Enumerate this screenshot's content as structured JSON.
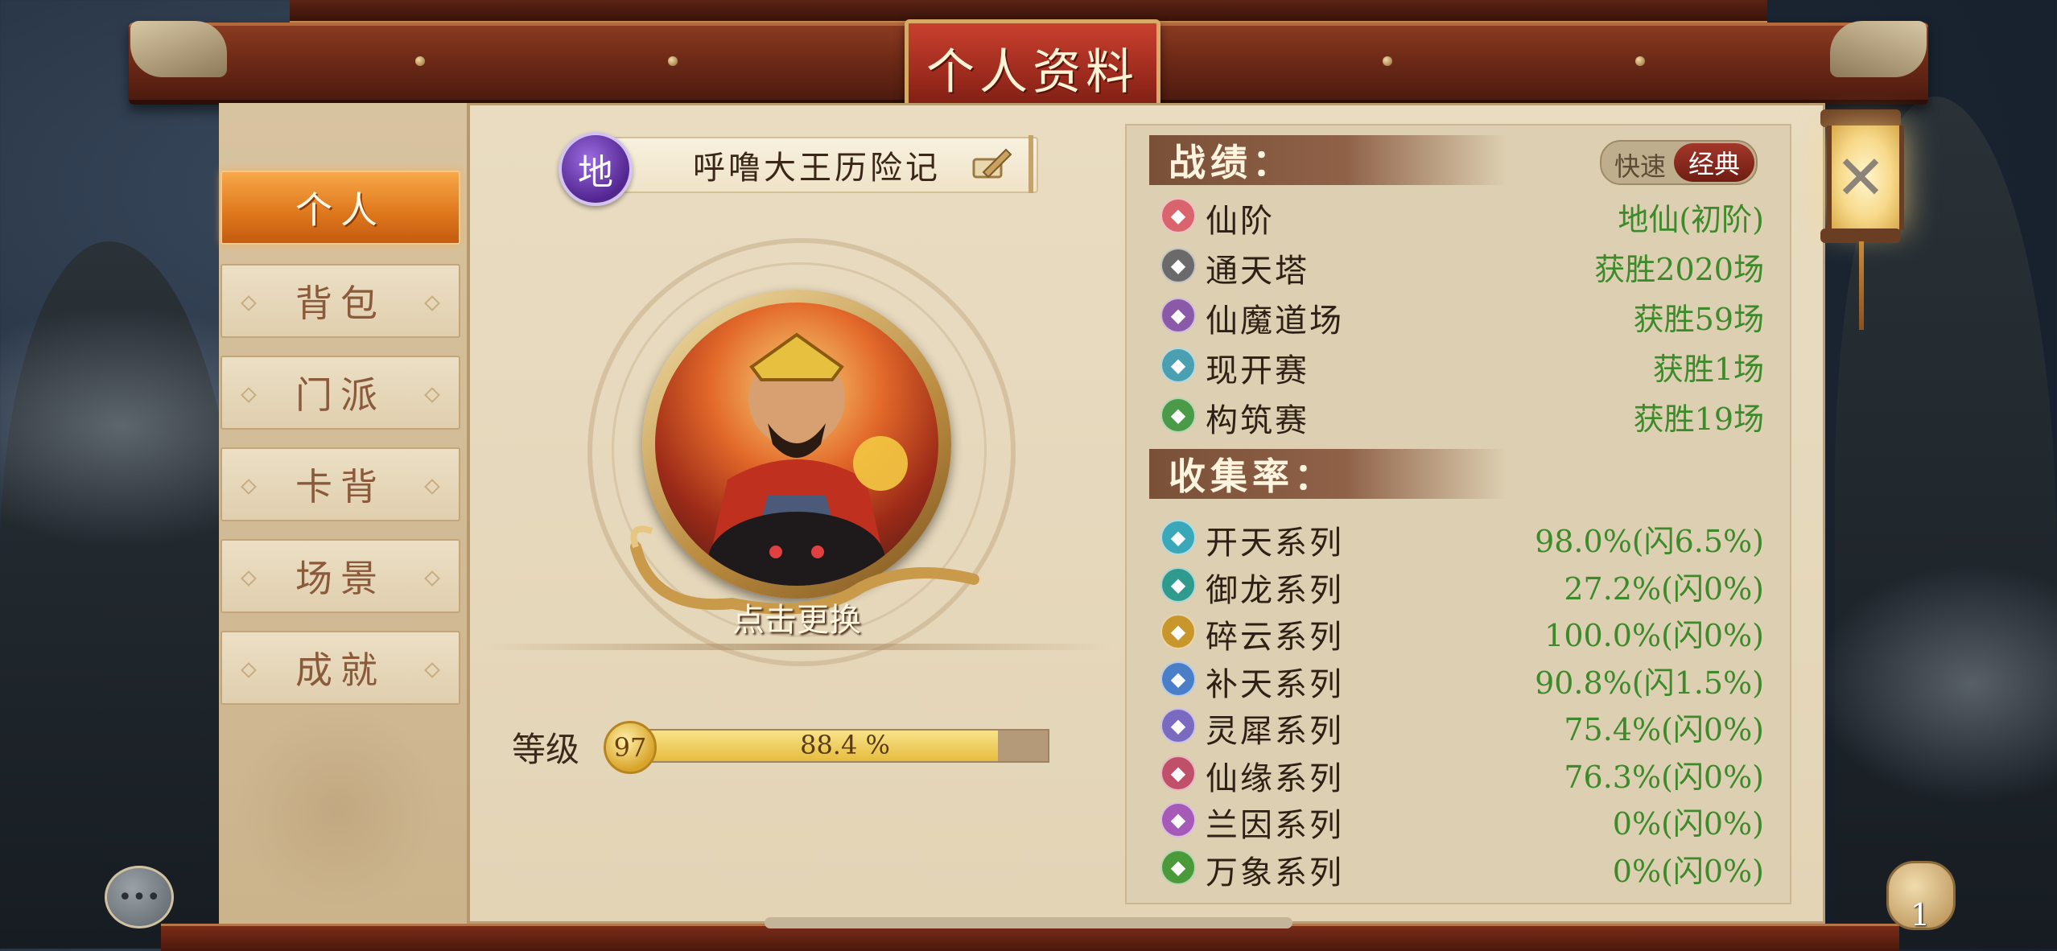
{
  "header": {
    "title": "个人资料"
  },
  "sidebar": {
    "items": [
      {
        "label": "个人",
        "active": true
      },
      {
        "label": "背包",
        "active": false
      },
      {
        "label": "门派",
        "active": false
      },
      {
        "label": "卡背",
        "active": false
      },
      {
        "label": "场景",
        "active": false
      },
      {
        "label": "成就",
        "active": false
      }
    ]
  },
  "profile": {
    "rank_badge": "地",
    "name": "呼噜大王历险记",
    "change_avatar_label": "点击更换",
    "level_label": "等级",
    "level": "97",
    "level_progress_text": "88.4 %",
    "level_progress": 0.884
  },
  "record": {
    "title": "战绩：",
    "mode_toggle": {
      "options": [
        "快速",
        "经典"
      ],
      "selected": "经典"
    },
    "rows": [
      {
        "icon": "star-icon",
        "icon_color": "#d9646e",
        "label": "仙阶",
        "value": "地仙(初阶)"
      },
      {
        "icon": "tower-icon",
        "icon_color": "#6a6a6a",
        "label": "通天塔",
        "value": "获胜2020场"
      },
      {
        "icon": "crane-icon",
        "icon_color": "#8a5aa8",
        "label": "仙魔道场",
        "value": "获胜59场"
      },
      {
        "icon": "search-icon",
        "icon_color": "#4aa0b0",
        "label": "现开赛",
        "value": "获胜1场"
      },
      {
        "icon": "build-icon",
        "icon_color": "#4a9a48",
        "label": "构筑赛",
        "value": "获胜19场"
      }
    ]
  },
  "collection": {
    "title": "收集率：",
    "rows": [
      {
        "icon": "kaitian-icon",
        "icon_color": "#3aa8b8",
        "label": "开天系列",
        "value": "98.0%(闪6.5%)"
      },
      {
        "icon": "dragon-icon",
        "icon_color": "#2f9a8e",
        "label": "御龙系列",
        "value": "27.2%(闪0%)"
      },
      {
        "icon": "cloud-icon",
        "icon_color": "#c8962a",
        "label": "碎云系列",
        "value": "100.0%(闪0%)"
      },
      {
        "icon": "sky-icon",
        "icon_color": "#4a7fc8",
        "label": "补天系列",
        "value": "90.8%(闪1.5%)"
      },
      {
        "icon": "rhino-icon",
        "icon_color": "#7a6ac0",
        "label": "灵犀系列",
        "value": "75.4%(闪0%)"
      },
      {
        "icon": "fate-icon",
        "icon_color": "#c0506a",
        "label": "仙缘系列",
        "value": "76.3%(闪0%)"
      },
      {
        "icon": "orchid-icon",
        "icon_color": "#a65ab8",
        "label": "兰因系列",
        "value": "0%(闪0%)"
      },
      {
        "icon": "leaf-icon",
        "icon_color": "#4a9a3a",
        "label": "万象系列",
        "value": "0%(闪0%)"
      }
    ]
  },
  "footer": {
    "bag_count": "1"
  },
  "colors": {
    "accent_orange": "#e07a1e",
    "value_green": "#3d8a2a",
    "title_red": "#9c2a1d"
  }
}
